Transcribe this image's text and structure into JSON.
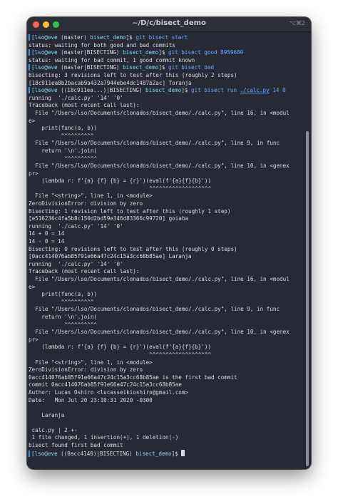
{
  "window": {
    "title": "~/D/c/bisect_demo",
    "shortcut": "⌥⌘2"
  },
  "prompts": [
    {
      "user": "[lso@eve",
      "state": " (master) ",
      "dir": "bisect_demo",
      "sym": "]$ ",
      "cmd": "git bisect start"
    },
    {
      "user": "[lso@eve",
      "state": " (master|BISECTING) ",
      "dir": "bisect_demo",
      "sym": "]$ ",
      "cmd": "git bisect good 8959689"
    },
    {
      "user": "[lso@eve",
      "state": " (master|BISECTING) ",
      "dir": "bisect_demo",
      "sym": "]$ ",
      "cmd": "git bisect bad"
    },
    {
      "user": "[lso@eve",
      "state": " ((18c911ea...)|BISECTING) ",
      "dir": "bisect_demo",
      "sym": "]$ ",
      "cmd": "git bisect run ",
      "cmd_link": "./calc.py",
      "cmd_tail": " 14 0"
    },
    {
      "user": "[lso@eve",
      "state": " ((0acc4140)|BISECTING) ",
      "dir": "bisect_demo",
      "sym": "]$ "
    }
  ],
  "output": {
    "block1": [
      "status: waiting for both good and bad commits"
    ],
    "block2": [
      "status: waiting for bad commit, 1 good commit known"
    ],
    "block3": [
      "Bisecting: 3 revisions left to test after this (roughly 2 steps)",
      "[18c911ea8b2bacab9a432a7944ebe4dc1487b2ac] Toranja"
    ],
    "block4": [
      "running  './calc.py' '14' '0'",
      "Traceback (most recent call last):",
      "  File \"/Users/lso/Documents/clonados/bisect_demo/./calc.py\", line 16, in <modul",
      "e>",
      "    print(func(a, b))",
      "          ^^^^^^^^^^",
      "  File \"/Users/lso/Documents/clonados/bisect_demo/./calc.py\", line 9, in func",
      "    return '\\n'.join(",
      "           ^^^^^^^^^^",
      "  File \"/Users/lso/Documents/clonados/bisect_demo/./calc.py\", line 10, in <genex",
      "pr>",
      "    (lambda r: f'{a} {f} {b} = {r}')(eval(f'{a}{f}{b}'))",
      "                                     ^^^^^^^^^^^^^^^^^^^",
      "  File \"<string>\", line 1, in <module>",
      "ZeroDivisionError: division by zero",
      "Bisecting: 1 revision left to test after this (roughly 1 step)",
      "[e516236c4fa5b8c150d2bd59e346d83366c99720] goiaba",
      "running  './calc.py' '14' '0'",
      "14 + 0 = 14",
      "14 - 0 = 14",
      "Bisecting: 0 revisions left to test after this (roughly 0 steps)",
      "[0acc414076ab85f91e66a47c24c15a3cc68b85ae] Laranja",
      "running  './calc.py' '14' '0'",
      "Traceback (most recent call last):",
      "  File \"/Users/lso/Documents/clonados/bisect_demo/./calc.py\", line 16, in <modul",
      "e>",
      "    print(func(a, b))",
      "          ^^^^^^^^^^",
      "  File \"/Users/lso/Documents/clonados/bisect_demo/./calc.py\", line 9, in func",
      "    return '\\n'.join(",
      "           ^^^^^^^^^^",
      "  File \"/Users/lso/Documents/clonados/bisect_demo/./calc.py\", line 10, in <genex",
      "pr>",
      "    (lambda r: f'{a} {f} {b} = {r}')(eval(f'{a}{f}{b}'))",
      "                                     ^^^^^^^^^^^^^^^^^^^",
      "  File \"<string>\", line 1, in <module>",
      "ZeroDivisionError: division by zero",
      "0acc414076ab85f91e66a47c24c15a3cc68b85ae is the first bad commit",
      "commit 0acc414076ab85f91e66a47c24c15a3cc68b85ae",
      "Author: Lucas Oshiro <lucasseikioshiro@gmail.com>",
      "Date:   Mon Jul 20 23:10:31 2020 -0300",
      "",
      "    Laranja",
      "",
      " calc.py | 2 +-",
      " 1 file changed, 1 insertion(+), 1 deletion(-)",
      "bisect found first bad commit"
    ]
  },
  "colors": {
    "background": "#272a35",
    "prompt_user": "#82d8f2",
    "command": "#69a6ff",
    "text": "#d9dbe0"
  }
}
